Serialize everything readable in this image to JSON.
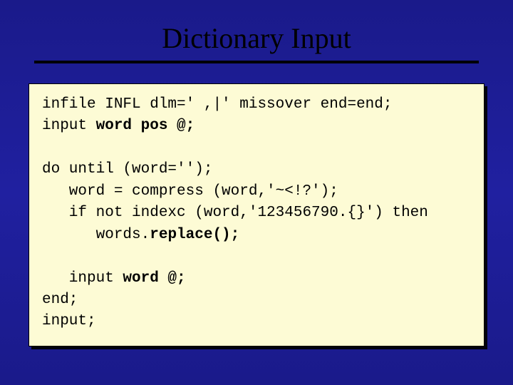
{
  "title": "Dictionary Input",
  "code": {
    "l1a": "infile INFL dlm=' ,|' missover end=end;",
    "l2a": "input ",
    "l2b": "word pos @;",
    "l3a": "do until (word='');",
    "l4a": "   word = compress (word,'~<!?');",
    "l5a": "   if not indexc (word,'123456790.{}') then",
    "l6a": "      words.",
    "l6b": "replace();",
    "l7a": "   input ",
    "l7b": "word @;",
    "l8a": "end;",
    "l9a": "input;"
  }
}
